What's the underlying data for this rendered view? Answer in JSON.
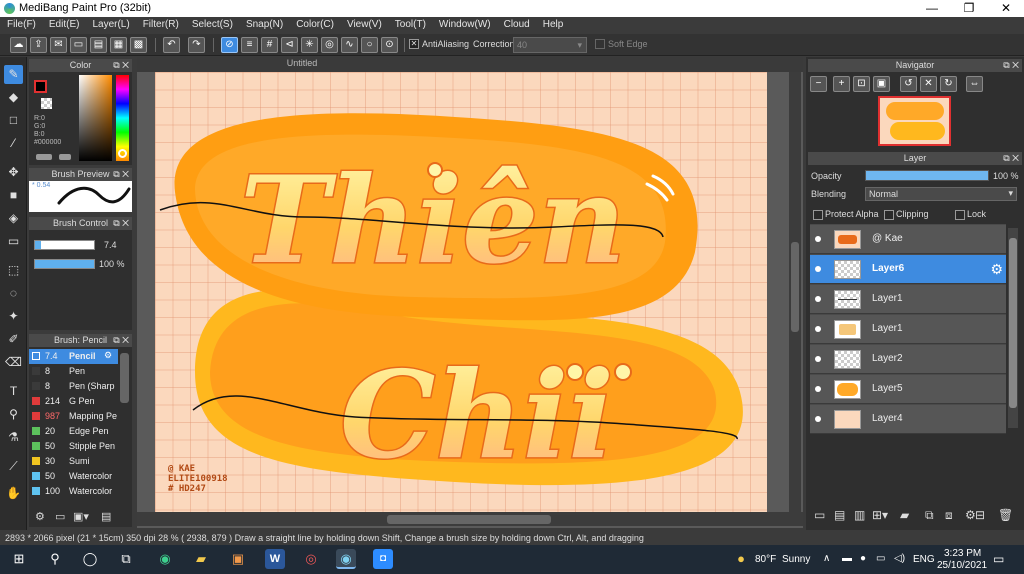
{
  "window": {
    "title": "MediBang Paint Pro (32bit)",
    "minimize": "—",
    "maximize": "❐",
    "close": "✕"
  },
  "menu": [
    "File(F)",
    "Edit(E)",
    "Layer(L)",
    "Filter(R)",
    "Select(S)",
    "Snap(N)",
    "Color(C)",
    "View(V)",
    "Tool(T)",
    "Window(W)",
    "Cloud",
    "Help"
  ],
  "toolbar": {
    "antialiasing_label": "AntiAliasing",
    "antialiasing_checked": true,
    "correction_label": "Correction",
    "correction_value": "40",
    "soft_edge_label": "Soft Edge",
    "soft_edge_checked": false
  },
  "color_panel": {
    "title": "Color",
    "r_label": "R:0",
    "g_label": "G:0",
    "b_label": "B:0",
    "hex": "#000000",
    "fg_color": "#000000",
    "bg_color": "#ffffff"
  },
  "brush_preview": {
    "title": "Brush Preview",
    "size_label": "* 0.54"
  },
  "brush_control": {
    "title": "Brush Control",
    "size": "7.4",
    "opacity": "100 %"
  },
  "brush_list": {
    "title": "Brush: Pencil",
    "items": [
      {
        "size": "7.4",
        "name": "Pencil",
        "color": "#3e8be0",
        "selected": true
      },
      {
        "size": "8",
        "name": "Pen",
        "color": "#3a3a3a"
      },
      {
        "size": "8",
        "name": "Pen (Sharp",
        "color": "#3a3a3a"
      },
      {
        "size": "214",
        "name": "G Pen",
        "color": "#e03b3b"
      },
      {
        "size": "987",
        "name": "Mapping Pe",
        "color": "#e03b3b"
      },
      {
        "size": "20",
        "name": "Edge Pen",
        "color": "#5cc15c"
      },
      {
        "size": "50",
        "name": "Stipple Pen",
        "color": "#5cc15c"
      },
      {
        "size": "30",
        "name": "Sumi",
        "color": "#f0c420"
      },
      {
        "size": "50",
        "name": "Watercolor",
        "color": "#5fc3f0"
      },
      {
        "size": "100",
        "name": "Watercolor",
        "color": "#5fc3f0"
      }
    ]
  },
  "canvas": {
    "title": "Untitled"
  },
  "artwork": {
    "word1": "Thiên",
    "word2": "Chii",
    "credit_lines": [
      "@ KAE",
      "ELITE100918",
      "# HD247"
    ]
  },
  "status": {
    "text": "2893 * 2066 pixel  (21 * 15cm)  350 dpi  28 %  ( 2938, 879 )  Draw a straight line by holding down Shift, Change a brush size by holding down Ctrl, Alt, and dragging"
  },
  "navigator": {
    "title": "Navigator"
  },
  "layer_panel": {
    "title": "Layer",
    "opacity_label": "Opacity",
    "opacity_value": "100 %",
    "opacity_fraction": 1.0,
    "blending_label": "Blending",
    "blending_value": "Normal",
    "protect_alpha_label": "Protect Alpha",
    "clipping_label": "Clipping",
    "lock_label": "Lock",
    "layers": [
      {
        "name": "@ Kae",
        "thumb": "kae",
        "selected": false
      },
      {
        "name": "Layer6",
        "thumb": "empty",
        "selected": true
      },
      {
        "name": "Layer1",
        "thumb": "lines",
        "selected": false
      },
      {
        "name": "Layer1",
        "thumb": "text",
        "selected": false
      },
      {
        "name": "Layer2",
        "thumb": "empty",
        "selected": false
      },
      {
        "name": "Layer5",
        "thumb": "orange",
        "selected": false
      },
      {
        "name": "Layer4",
        "thumb": "peach",
        "selected": false
      }
    ]
  },
  "taskbar": {
    "weather_temp": "80°F",
    "weather_desc": "Sunny",
    "language": "ENG",
    "time": "3:23 PM",
    "date": "25/10/2021"
  }
}
